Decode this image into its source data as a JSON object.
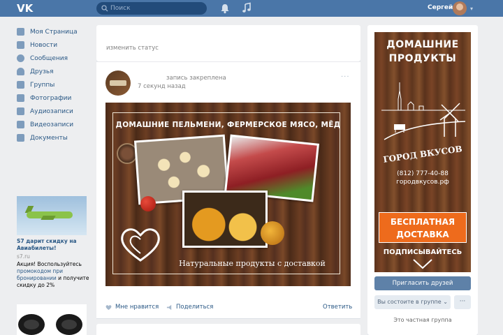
{
  "header": {
    "logo": "VK",
    "search_placeholder": "Поиск",
    "username": "Сергей",
    "icons": [
      "search-icon",
      "bell-icon",
      "music-icon",
      "chevron-down-icon"
    ]
  },
  "nav": {
    "items": [
      {
        "label": "Моя Страница",
        "icon": "home-icon"
      },
      {
        "label": "Новости",
        "icon": "news-icon"
      },
      {
        "label": "Сообщения",
        "icon": "messages-icon"
      },
      {
        "label": "Друзья",
        "icon": "friends-icon"
      },
      {
        "label": "Группы",
        "icon": "groups-icon"
      },
      {
        "label": "Фотографии",
        "icon": "camera-icon"
      },
      {
        "label": "Аудиозаписи",
        "icon": "music-icon"
      },
      {
        "label": "Видеозаписи",
        "icon": "video-icon"
      },
      {
        "label": "Документы",
        "icon": "document-icon"
      }
    ]
  },
  "ads": {
    "ad1": {
      "title": "S7 дарит скидку на Авиабилеты!",
      "domain": "s7.ru",
      "text_1": "Акция! Воспользуйтесь",
      "text_highlight": "промокодом при бронировании",
      "text_2": "и получите скидку до 2%"
    }
  },
  "status": {
    "text": "изменить статус"
  },
  "post": {
    "pinned": "запись закреплена",
    "time": "7 секунд назад",
    "image": {
      "headline": "ДОМАШНИЕ ПЕЛЬМЕНИ, ФЕРМЕРСКОЕ МЯСО, МЁД",
      "footer": "Натуральные продукты с доставкой"
    },
    "actions": {
      "like": "Мне нравится",
      "share": "Поделиться",
      "comment": "Ответить"
    }
  },
  "group": {
    "banner": {
      "title_line1": "ДОМАШНИЕ",
      "title_line2": "ПРОДУКТЫ",
      "name": "ГОРОД ВКУСОВ",
      "phone": "(812) 777-40-88",
      "site": "городвкусов.рф",
      "delivery_line1": "БЕСПЛАТНАЯ",
      "delivery_line2": "ДОСТАВКА",
      "subscribe": "ПОДПИСЫВАЙТЕСЬ"
    },
    "invite_button": "Пригласить друзей",
    "member_button": "Вы состоите в группе",
    "member_caret": "⌄",
    "more_button": "···",
    "private_text": "Это частная группа"
  },
  "colors": {
    "header_bg": "#4a76a8",
    "link": "#2a5885",
    "page_bg": "#edeef0",
    "orange": "#ee6b1c"
  }
}
